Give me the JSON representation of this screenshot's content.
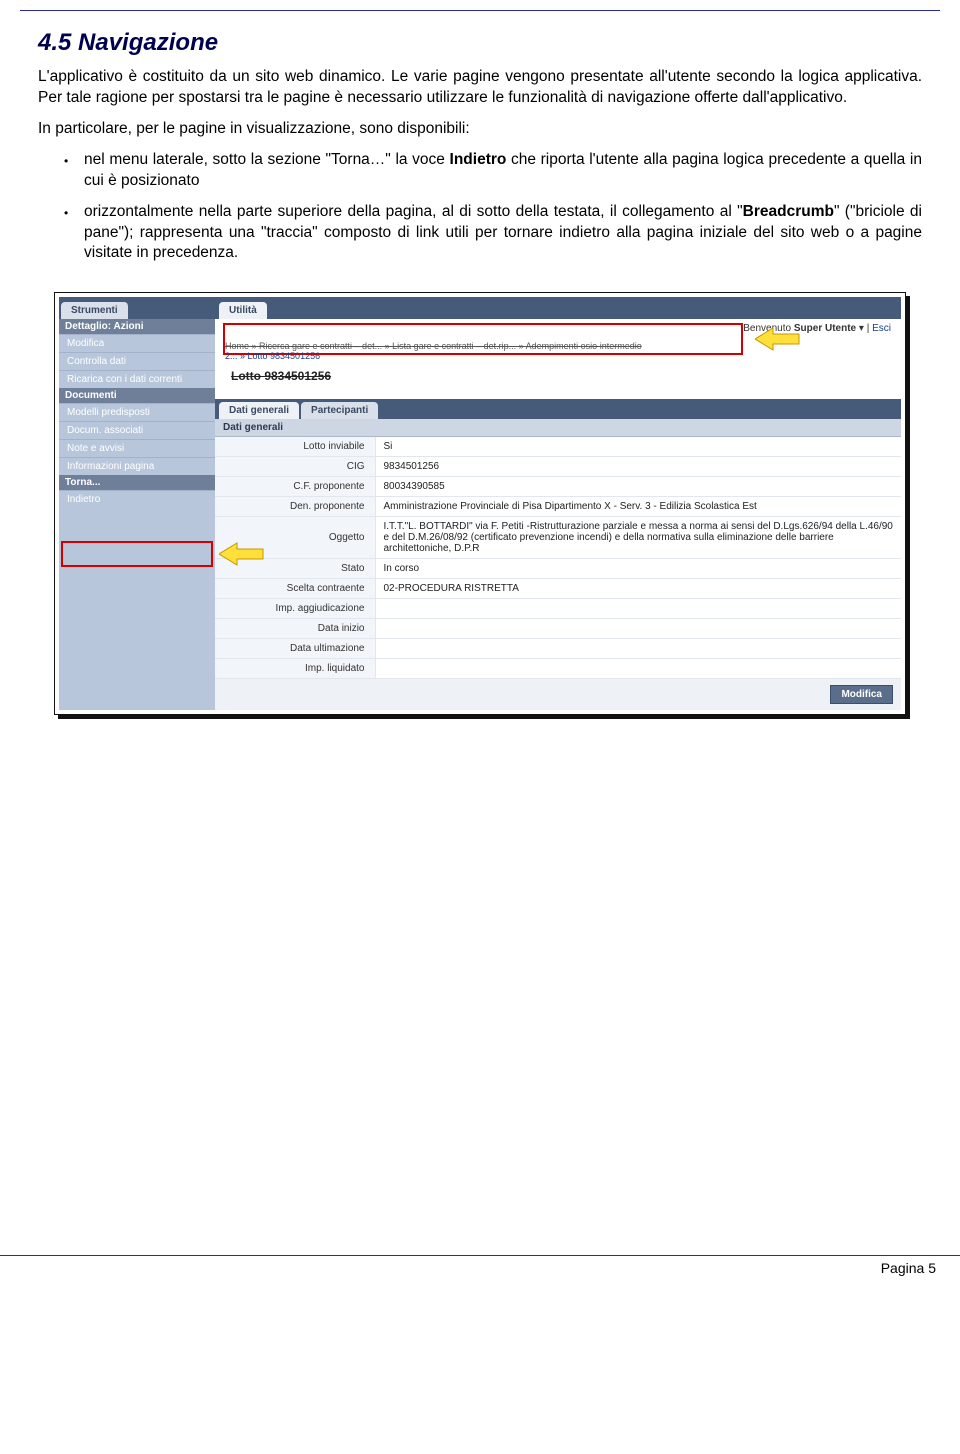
{
  "section": {
    "heading": "4.5  Navigazione",
    "para1": "L'applicativo è costituito da un sito web dinamico. Le varie pagine vengono presentate all'utente secondo la logica applicativa. Per tale ragione per spostarsi tra le pagine è necessario utilizzare le funzionalità di navigazione offerte dall'applicativo.",
    "para2": "In particolare, per le pagine in visualizzazione, sono disponibili:",
    "bullet1_pre": "nel menu laterale, sotto la sezione \"Torna…\" la voce ",
    "bullet1_bold": "Indietro",
    "bullet1_post": " che riporta l'utente alla pagina logica precedente a quella in cui è posizionato",
    "bullet2_pre": "orizzontalmente nella parte superiore della pagina, al di sotto della testata, il collegamento al \"",
    "bullet2_bold": "Breadcrumb",
    "bullet2_post": "\" (\"briciole di pane\"); rappresenta una \"traccia\" composto di link utili per tornare indietro alla pagina iniziale del sito web o a pagine visitate in precedenza."
  },
  "screenshot": {
    "top_tabs": {
      "strumenti": "Strumenti",
      "utilita": "Utilità"
    },
    "userbar": {
      "benvenuto": "Benvenuto",
      "user": "Super Utente",
      "sep": " | ",
      "esci": "Esci"
    },
    "sidebar": {
      "group1_title": "Dettaglio: Azioni",
      "group1_items": [
        "Modifica",
        "Controlla dati",
        "Ricarica con i dati correnti"
      ],
      "group2_title": "Documenti",
      "group2_items": [
        "Modelli predisposti",
        "Docum. associati",
        "Note e avvisi",
        "Informazioni pagina"
      ],
      "group3_title": "Torna...",
      "group3_items": [
        "Indietro"
      ]
    },
    "breadcrumb": {
      "line1": "Home » Ricerca gare e contratti – det... » Lista gare e contratti – det.rip... » Adempimenti osio intermedio",
      "line2_pre": "2... » ",
      "line2_strong": "Lotto 9834501256"
    },
    "lotto_title": "Lotto 9834501256",
    "inner_tabs": {
      "dati": "Dati generali",
      "partecipanti": "Partecipanti"
    },
    "section_head": "Dati generali",
    "rows": [
      {
        "label": "Lotto inviabile",
        "value": "Si"
      },
      {
        "label": "CIG",
        "value": "9834501256"
      },
      {
        "label": "C.F. proponente",
        "value": "80034390585"
      },
      {
        "label": "Den. proponente",
        "value": "Amministrazione Provinciale di Pisa Dipartimento X - Serv. 3 - Edilizia Scolastica Est"
      },
      {
        "label": "Oggetto",
        "value": "I.T.T.\"L. BOTTARDI\" via F. Petiti -Ristrutturazione parziale e messa a norma ai sensi del D.Lgs.626/94 della L.46/90 e del D.M.26/08/92 (certificato prevenzione incendi) e della normativa sulla eliminazione delle barriere architettoniche, D.P.R"
      },
      {
        "label": "Stato",
        "value": "In corso"
      },
      {
        "label": "Scelta contraente",
        "value": "02-PROCEDURA RISTRETTA"
      },
      {
        "label": "Imp. aggiudicazione",
        "value": ""
      },
      {
        "label": "Data inizio",
        "value": ""
      },
      {
        "label": "Data ultimazione",
        "value": ""
      },
      {
        "label": "Imp. liquidato",
        "value": ""
      }
    ],
    "modify_btn": "Modifica"
  },
  "footer": {
    "label": "Pagina",
    "num": "5"
  }
}
